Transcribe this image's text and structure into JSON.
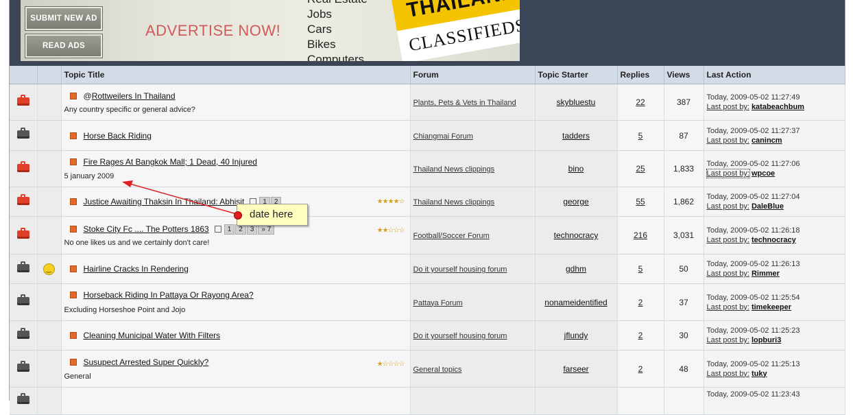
{
  "ad": {
    "submit_label": "SUBMIT NEW AD",
    "read_label": "READ ADS",
    "advertise": "ADVERTISE NOW!",
    "categories": [
      "Real Estate",
      "Jobs",
      "Cars",
      "Bikes",
      "Computers"
    ],
    "logo_top": "THAILAND",
    "logo_bottom": "CLASSIFIEDS"
  },
  "columns": {
    "title": "Topic Title",
    "forum": "Forum",
    "starter": "Topic Starter",
    "replies": "Replies",
    "views": "Views",
    "last": "Last Action"
  },
  "rows": [
    {
      "title": "Rottweilers In Thailand",
      "prefix": "@",
      "desc": "Any country specific or general advice?",
      "forum": "Plants, Pets & Vets in Thailand",
      "starter": "skybluestu",
      "replies": "22",
      "views": "387",
      "time": "Today, 2009-05-02 11:27:49",
      "last_label": "Last post by:",
      "last_user": "katabeachbum",
      "folder": "hot"
    },
    {
      "title": "Horse Back Riding",
      "forum": "Chiangmai Forum",
      "starter": "tadders",
      "replies": "5",
      "views": "87",
      "time": "Today, 2009-05-02 11:27:37",
      "last_label": "Last post by:",
      "last_user": "canincm",
      "folder": "cold"
    },
    {
      "title": "Fire Rages At Bangkok Mall; 1 Dead, 40 Injured",
      "desc": "5 january 2009",
      "forum": "Thailand News clippings",
      "starter": "bino",
      "replies": "25",
      "views": "1,833",
      "time": "Today, 2009-05-02 11:27:06",
      "last_label": "Last post by:",
      "last_user": "wpcoe",
      "folder": "hot"
    },
    {
      "title": "Justice Awaiting Thaksin In Thailand: Abhisit",
      "pages": [
        "1",
        "2"
      ],
      "rating": "★★★★☆",
      "forum": "Thailand News clippings",
      "starter": "george",
      "replies": "55",
      "views": "1,862",
      "time": "Today, 2009-05-02 11:27:04",
      "last_label": "Last post by:",
      "last_user": "DaleBlue",
      "folder": "hot"
    },
    {
      "title": "Stoke City Fc .... The Potters 1863",
      "pages": [
        "1",
        "2",
        "3",
        "» 7"
      ],
      "rating": "★★☆☆☆",
      "desc": "No one likes us and we certainly don't care!",
      "forum": "Football/Soccer Forum",
      "starter": "technocracy",
      "replies": "216",
      "views": "3,031",
      "time": "Today, 2009-05-02 11:26:18",
      "last_label": "Last post by:",
      "last_user": "technocracy",
      "folder": "hot"
    },
    {
      "title": "Hairline Cracks In Rendering",
      "forum": "Do it yourself housing forum",
      "starter": "gdhm",
      "replies": "5",
      "views": "50",
      "time": "Today, 2009-05-02 11:26:13",
      "last_label": "Last post by:",
      "last_user": "Rimmer",
      "folder": "cold",
      "smile": true
    },
    {
      "title": "Horseback Riding In Pattaya Or Rayong Area?",
      "desc": "Excluding Horseshoe Point and Jojo",
      "forum": "Pattaya Forum",
      "starter": "nonameidentified",
      "replies": "2",
      "views": "37",
      "time": "Today, 2009-05-02 11:25:54",
      "last_label": "Last post by:",
      "last_user": "timekeeper",
      "folder": "cold"
    },
    {
      "title": "Cleaning Municipal Water With Filters",
      "forum": "Do it yourself housing forum",
      "starter": "jflundy",
      "replies": "2",
      "views": "30",
      "time": "Today, 2009-05-02 11:25:23",
      "last_label": "Last post by:",
      "last_user": "lopburi3",
      "folder": "cold"
    },
    {
      "title": "Susupect Arrested Super Quickly?",
      "rating": "★☆☆☆☆",
      "desc": "General",
      "forum": "General topics",
      "starter": "farseer",
      "replies": "2",
      "views": "48",
      "time": "Today, 2009-05-02 11:25:13",
      "last_label": "Last post by:",
      "last_user": "tuky",
      "folder": "cold"
    },
    {
      "title": "",
      "forum": "",
      "starter": "",
      "replies": "",
      "views": "",
      "time": "Today, 2009-05-02 11:23:43",
      "last_label": "",
      "last_user": "",
      "folder": "cold"
    }
  ],
  "callout": {
    "text": "date here"
  },
  "colors": {
    "header_bg": "#d2dbe6",
    "banner_bg": "#3a4556",
    "hot_folder": "#e0402a",
    "bullet": "#e06a2a"
  }
}
